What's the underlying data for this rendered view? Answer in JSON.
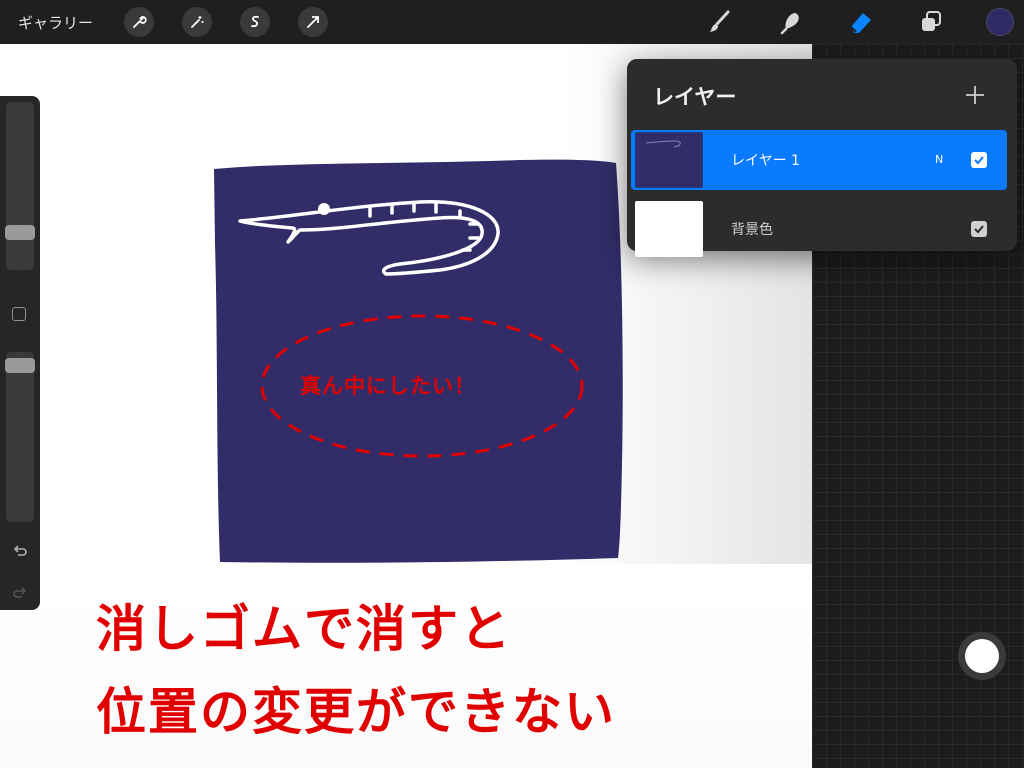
{
  "toolbar": {
    "gallery_label": "ギャラリー",
    "left_tools": [
      "wrench-icon",
      "magic-wand-icon",
      "selection-icon",
      "transform-arrow-icon"
    ],
    "right_tools": [
      "brush-icon",
      "smudge-icon",
      "eraser-icon",
      "layers-icon"
    ],
    "active_tool": "eraser-icon",
    "current_color": "#2f2a66",
    "accent_color": "#0a7aff"
  },
  "layers_panel": {
    "title": "レイヤー",
    "layers": [
      {
        "name": "レイヤー 1",
        "blend_mode": "N",
        "visible": true,
        "selected": true
      },
      {
        "name": "背景色",
        "visible": true,
        "selected": false
      }
    ]
  },
  "canvas": {
    "annotation": "真ん中にしたい！",
    "caption_line1": "消しゴムで消すと",
    "caption_line2": "位置の変更ができない",
    "square_color": "#322d69",
    "annotation_color": "#e00000"
  },
  "sidebar": {
    "brush_size_level": 0.78,
    "opacity_level": 0.03
  }
}
